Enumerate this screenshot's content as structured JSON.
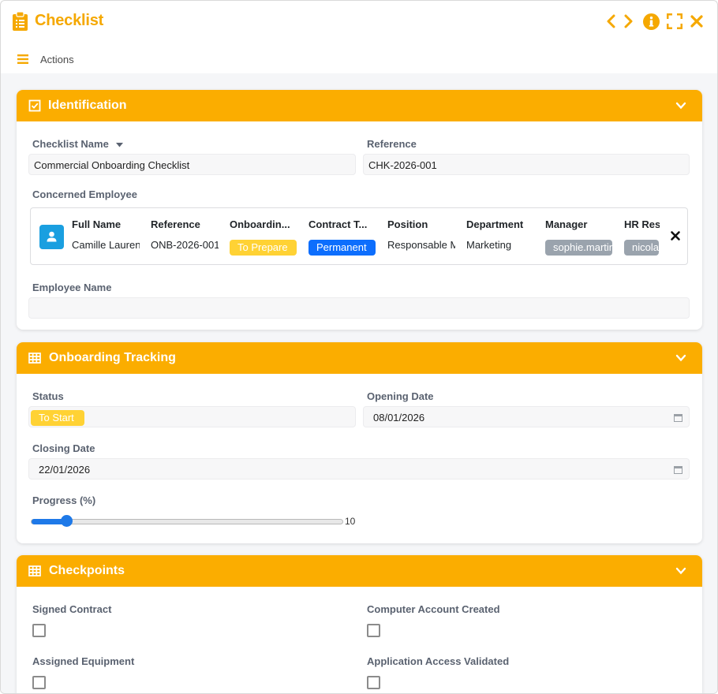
{
  "window": {
    "title": "Checklist",
    "icons": [
      "clipboard-icon",
      "chevron-left-icon",
      "chevron-right-icon",
      "info-icon",
      "expand-icon",
      "close-icon"
    ],
    "accent": "#f5a800"
  },
  "toolbar": {
    "actions_label": "Actions"
  },
  "identification": {
    "title": "Identification",
    "checklist_name_label": "Checklist Name",
    "checklist_name_value": "Commercial Onboarding Checklist",
    "reference_label": "Reference",
    "reference_value": "CHK-2026-001",
    "concerned_employee_label": "Concerned Employee",
    "employee_columns": [
      "Full Name",
      "Reference",
      "Onboardin...",
      "Contract T...",
      "Position",
      "Department",
      "Manager",
      "HR Res"
    ],
    "employee_row": {
      "full_name": "Camille Laurent",
      "reference": "ONB-2026-001",
      "onboarding": "To Prepare",
      "contract": "Permanent",
      "position": "Responsable Marketing",
      "department": "Marketing",
      "manager": "sophie.martin",
      "hr": "nicolas"
    },
    "employee_name_label": "Employee Name",
    "employee_name_value": ""
  },
  "tracking": {
    "title": "Onboarding Tracking",
    "status_label": "Status",
    "status_value": "To Start",
    "opening_date_label": "Opening Date",
    "opening_date_value": "08/01/2026",
    "closing_date_label": "Closing Date",
    "closing_date_value": "22/01/2026",
    "progress_label": "Progress (%)",
    "progress_value": "10"
  },
  "checkpoints": {
    "title": "Checkpoints",
    "items": [
      {
        "label": "Signed Contract",
        "checked": false
      },
      {
        "label": "Computer Account Created",
        "checked": false
      },
      {
        "label": "Assigned Equipment",
        "checked": false
      },
      {
        "label": "Application Access Validated",
        "checked": false
      }
    ]
  },
  "colors": {
    "header": "#fbad00",
    "to_prepare": "#ffd234",
    "permanent": "#0d6efd",
    "person_badge": "#9aa3ad",
    "slider": "#1e79e8",
    "avatar": "#1a9fe0"
  }
}
